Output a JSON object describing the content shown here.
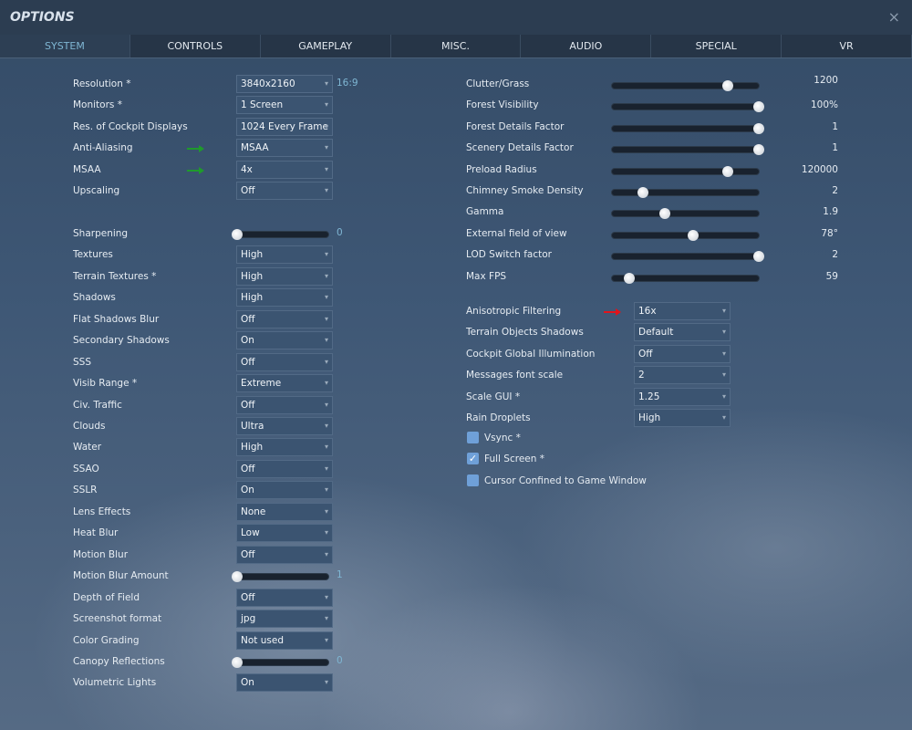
{
  "window": {
    "title": "OPTIONS",
    "close": "×"
  },
  "tabs": [
    "SYSTEM",
    "CONTROLS",
    "GAMEPLAY",
    "MISC.",
    "AUDIO",
    "SPECIAL",
    "VR"
  ],
  "active_tab": 0,
  "left": [
    {
      "label": "Resolution *",
      "type": "dropdown",
      "value": "3840x2160",
      "extra": "16:9"
    },
    {
      "label": "Monitors *",
      "type": "dropdown",
      "value": "1 Screen"
    },
    {
      "label": "Res. of Cockpit Displays",
      "type": "dropdown",
      "value": "1024 Every Frame"
    },
    {
      "label": "Anti-Aliasing",
      "type": "dropdown",
      "value": "MSAA",
      "arrow": "green"
    },
    {
      "label": "MSAA",
      "type": "dropdown",
      "value": "4x",
      "arrow": "green"
    },
    {
      "label": "Upscaling",
      "type": "dropdown",
      "value": "Off"
    },
    {
      "label": "Sharpening",
      "type": "slider",
      "value": "0",
      "fraction": 0
    },
    {
      "label": "Textures",
      "type": "dropdown",
      "value": "High"
    },
    {
      "label": "Terrain Textures *",
      "type": "dropdown",
      "value": "High"
    },
    {
      "label": "Shadows",
      "type": "dropdown",
      "value": "High"
    },
    {
      "label": "Flat Shadows Blur",
      "type": "dropdown",
      "value": "Off"
    },
    {
      "label": "Secondary Shadows",
      "type": "dropdown",
      "value": "On"
    },
    {
      "label": "SSS",
      "type": "dropdown",
      "value": "Off"
    },
    {
      "label": "Visib Range *",
      "type": "dropdown",
      "value": "Extreme"
    },
    {
      "label": "Civ. Traffic",
      "type": "dropdown",
      "value": "Off"
    },
    {
      "label": "Clouds",
      "type": "dropdown",
      "value": "Ultra"
    },
    {
      "label": "Water",
      "type": "dropdown",
      "value": "High"
    },
    {
      "label": "SSAO",
      "type": "dropdown",
      "value": "Off"
    },
    {
      "label": "SSLR",
      "type": "dropdown",
      "value": "On"
    },
    {
      "label": "Lens Effects",
      "type": "dropdown",
      "value": "None"
    },
    {
      "label": "Heat Blur",
      "type": "dropdown",
      "value": "Low"
    },
    {
      "label": "Motion Blur",
      "type": "dropdown",
      "value": "Off"
    },
    {
      "label": "Motion Blur Amount",
      "type": "slider",
      "value": "1",
      "fraction": 0
    },
    {
      "label": "Depth of Field",
      "type": "dropdown",
      "value": "Off"
    },
    {
      "label": "Screenshot format",
      "type": "dropdown",
      "value": "jpg"
    },
    {
      "label": "Color Grading",
      "type": "dropdown",
      "value": "Not used"
    },
    {
      "label": "Canopy Reflections",
      "type": "slider",
      "value": "0",
      "fraction": 0
    },
    {
      "label": "Volumetric Lights",
      "type": "dropdown",
      "value": "On"
    }
  ],
  "right_sliders": [
    {
      "label": "Clutter/Grass",
      "value": "1200",
      "fraction": 0.79
    },
    {
      "label": "Forest Visibility",
      "value": "100%",
      "fraction": 1
    },
    {
      "label": "Forest Details Factor",
      "value": "1",
      "fraction": 1
    },
    {
      "label": "Scenery Details Factor",
      "value": "1",
      "fraction": 1
    },
    {
      "label": "Preload Radius",
      "value": "120000",
      "fraction": 0.79
    },
    {
      "label": "Chimney Smoke Density",
      "value": "2",
      "fraction": 0.21
    },
    {
      "label": "Gamma",
      "value": "1.9",
      "fraction": 0.36
    },
    {
      "label": "External field of view",
      "value": "78°",
      "fraction": 0.55
    },
    {
      "label": "LOD Switch factor",
      "value": "2",
      "fraction": 1
    },
    {
      "label": "Max FPS",
      "value": "59",
      "fraction": 0.12
    }
  ],
  "right_dropdowns": [
    {
      "label": "Anisotropic Filtering",
      "value": "16x",
      "arrow": "red"
    },
    {
      "label": "Terrain Objects Shadows",
      "value": "Default"
    },
    {
      "label": " Cockpit Global Illumination",
      "value": "Off"
    },
    {
      "label": "Messages font scale",
      "value": "2"
    },
    {
      "label": "Scale GUI *",
      "value": "1.25"
    },
    {
      "label": "Rain Droplets",
      "value": "High"
    }
  ],
  "checkboxes": [
    {
      "label": "Vsync *",
      "checked": false
    },
    {
      "label": "Full Screen *",
      "checked": true
    },
    {
      "label": "Cursor Confined to Game Window",
      "checked": false
    }
  ],
  "colors": {
    "green": "#1f9a2c",
    "red": "#e0141c",
    "accent": "#7fb6d3"
  }
}
